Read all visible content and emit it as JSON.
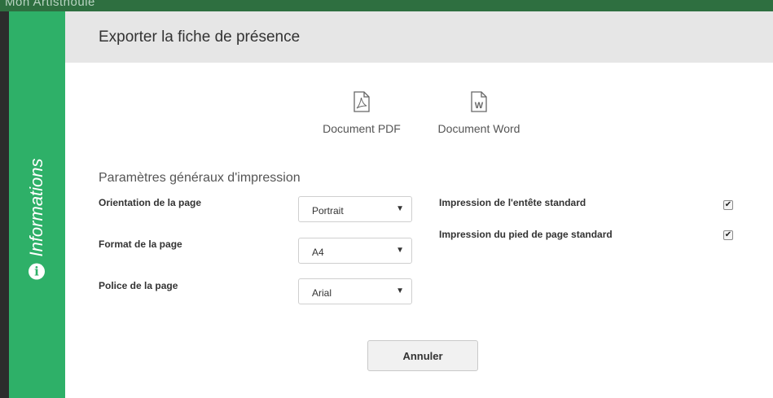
{
  "background": {
    "app_title": "Mon Artisthoule"
  },
  "sidebar": {
    "label": "Informations",
    "icon": "info-icon"
  },
  "dialog": {
    "title": "Exporter la fiche de présence",
    "export_options": [
      {
        "label": "Document PDF",
        "icon": "pdf-document-icon"
      },
      {
        "label": "Document Word",
        "icon": "word-document-icon",
        "icon_letter": "W"
      }
    ],
    "section_title": "Paramètres généraux d'impression",
    "fields": [
      {
        "label": "Orientation de la page",
        "value": "Portrait"
      },
      {
        "label": "Format de la page",
        "value": "A4"
      },
      {
        "label": "Police de la page",
        "value": "Arial"
      }
    ],
    "checkboxes": [
      {
        "label": "Impression de l'entête standard",
        "checked": true,
        "mark": "✔"
      },
      {
        "label": "Impression du pied de page standard",
        "checked": true,
        "mark": "✔"
      }
    ],
    "cancel_label": "Annuler"
  },
  "colors": {
    "accent": "#2eb068",
    "header_bg": "#e6e6e6",
    "background_bar": "#2e6f40"
  }
}
